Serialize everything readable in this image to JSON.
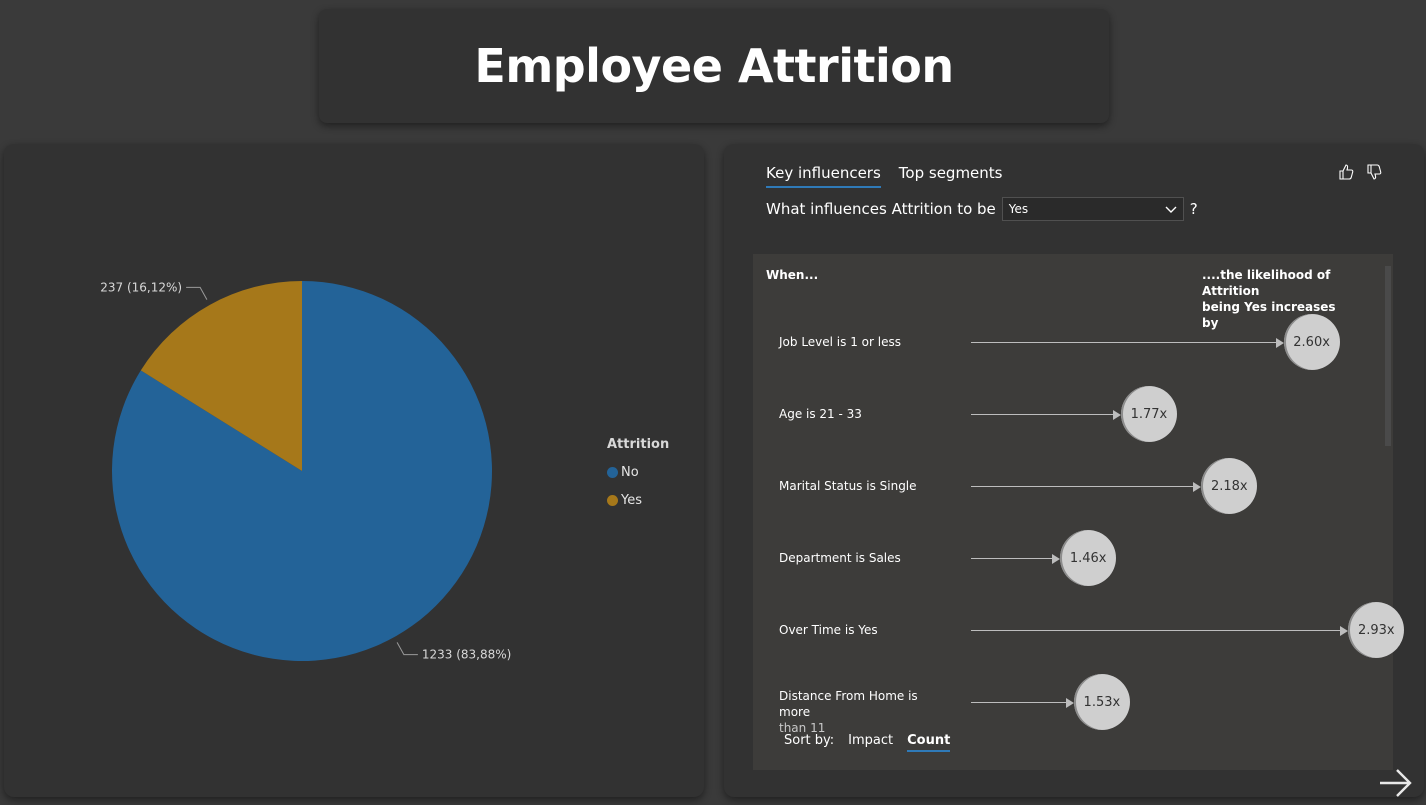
{
  "title": "Employee Attrition",
  "chart_data": {
    "type": "pie",
    "slices": [
      {
        "name": "No",
        "value": 1233,
        "label": "1233 (83,88%)",
        "color": "#236398"
      },
      {
        "name": "Yes",
        "value": 237,
        "label": "237 (16,12%)",
        "color": "#a6781a"
      }
    ]
  },
  "legend": {
    "title": "Attrition",
    "items": [
      {
        "label": "No",
        "color": "#236398"
      },
      {
        "label": "Yes",
        "color": "#a6781a"
      }
    ]
  },
  "influencers": {
    "tabs": [
      "Key influencers",
      "Top segments"
    ],
    "question_prefix": "What influences Attrition to be",
    "selected_value": "Yes",
    "question_suffix": "?",
    "header_left": "When...",
    "header_right_1": "....the likelihood of Attrition",
    "header_right_2": "being Yes increases by",
    "rows": [
      {
        "label": "Job Level is 1 or less",
        "label_wrap": "",
        "value": "2.60x",
        "factor": 2.6
      },
      {
        "label": "Age is 21 - 33",
        "label_wrap": "",
        "value": "1.77x",
        "factor": 1.77
      },
      {
        "label": "Marital Status is Single",
        "label_wrap": "",
        "value": "2.18x",
        "factor": 2.18
      },
      {
        "label": "Department is Sales",
        "label_wrap": "",
        "value": "1.46x",
        "factor": 1.46
      },
      {
        "label": "Over Time is Yes",
        "label_wrap": "",
        "value": "2.93x",
        "factor": 2.93
      },
      {
        "label": "Distance From Home is more",
        "label_wrap": "than 11",
        "value": "1.53x",
        "factor": 1.53
      }
    ],
    "sort_label": "Sort by:",
    "sort_options": [
      "Impact",
      "Count"
    ],
    "sort_active": "Count",
    "accent_color": "#2f7ab8"
  }
}
